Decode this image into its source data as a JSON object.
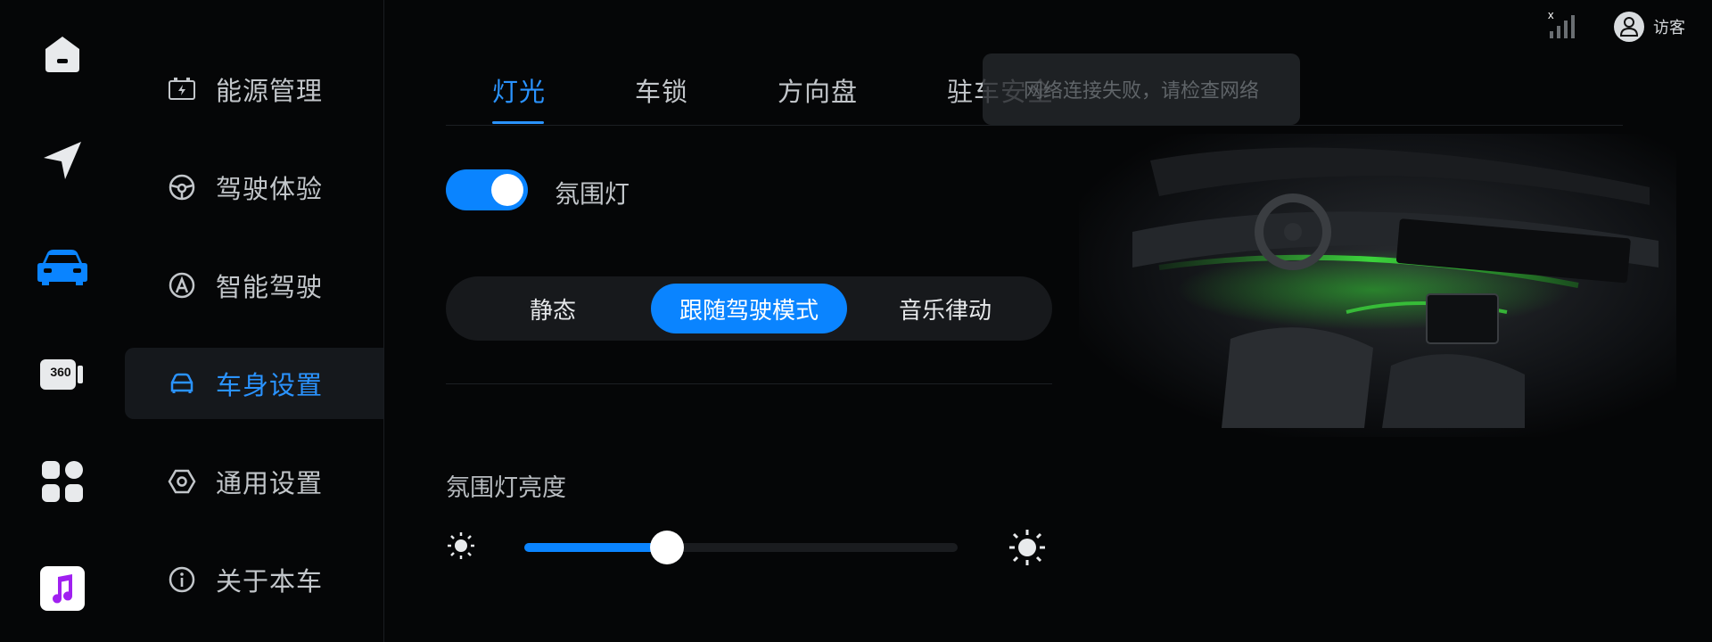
{
  "rail": {
    "items": [
      {
        "icon": "home-icon"
      },
      {
        "icon": "navigation-icon"
      },
      {
        "icon": "car-icon",
        "active": true
      },
      {
        "icon": "camera-360-icon",
        "text": "360"
      },
      {
        "icon": "apps-icon"
      },
      {
        "icon": "music-icon"
      }
    ]
  },
  "menu": {
    "items": [
      {
        "label": "能源管理",
        "icon": "battery-icon"
      },
      {
        "label": "驾驶体验",
        "icon": "steering-wheel-icon"
      },
      {
        "label": "智能驾驶",
        "icon": "autopilot-icon"
      },
      {
        "label": "车身设置",
        "icon": "car-body-icon",
        "active": true
      },
      {
        "label": "通用设置",
        "icon": "settings-hex-icon"
      },
      {
        "label": "关于本车",
        "icon": "info-icon"
      }
    ]
  },
  "status": {
    "signal_mark": "x",
    "user": "访客"
  },
  "tabs": [
    {
      "label": "灯光",
      "active": true
    },
    {
      "label": "车锁"
    },
    {
      "label": "方向盘"
    },
    {
      "label": "驻车安全"
    }
  ],
  "toast": {
    "text": "网络连接失败，请检查网络"
  },
  "ambient": {
    "toggle_label": "氛围灯",
    "toggle_on": true,
    "modes": [
      {
        "label": "静态"
      },
      {
        "label": "跟随驾驶模式",
        "active": true
      },
      {
        "label": "音乐律动"
      }
    ],
    "brightness_label": "氛围灯亮度",
    "brightness_fraction": 0.33
  },
  "colors": {
    "accent": "#0a84ff",
    "active_text": "#2a93ff",
    "ambient_glow": "#3cd43c"
  }
}
